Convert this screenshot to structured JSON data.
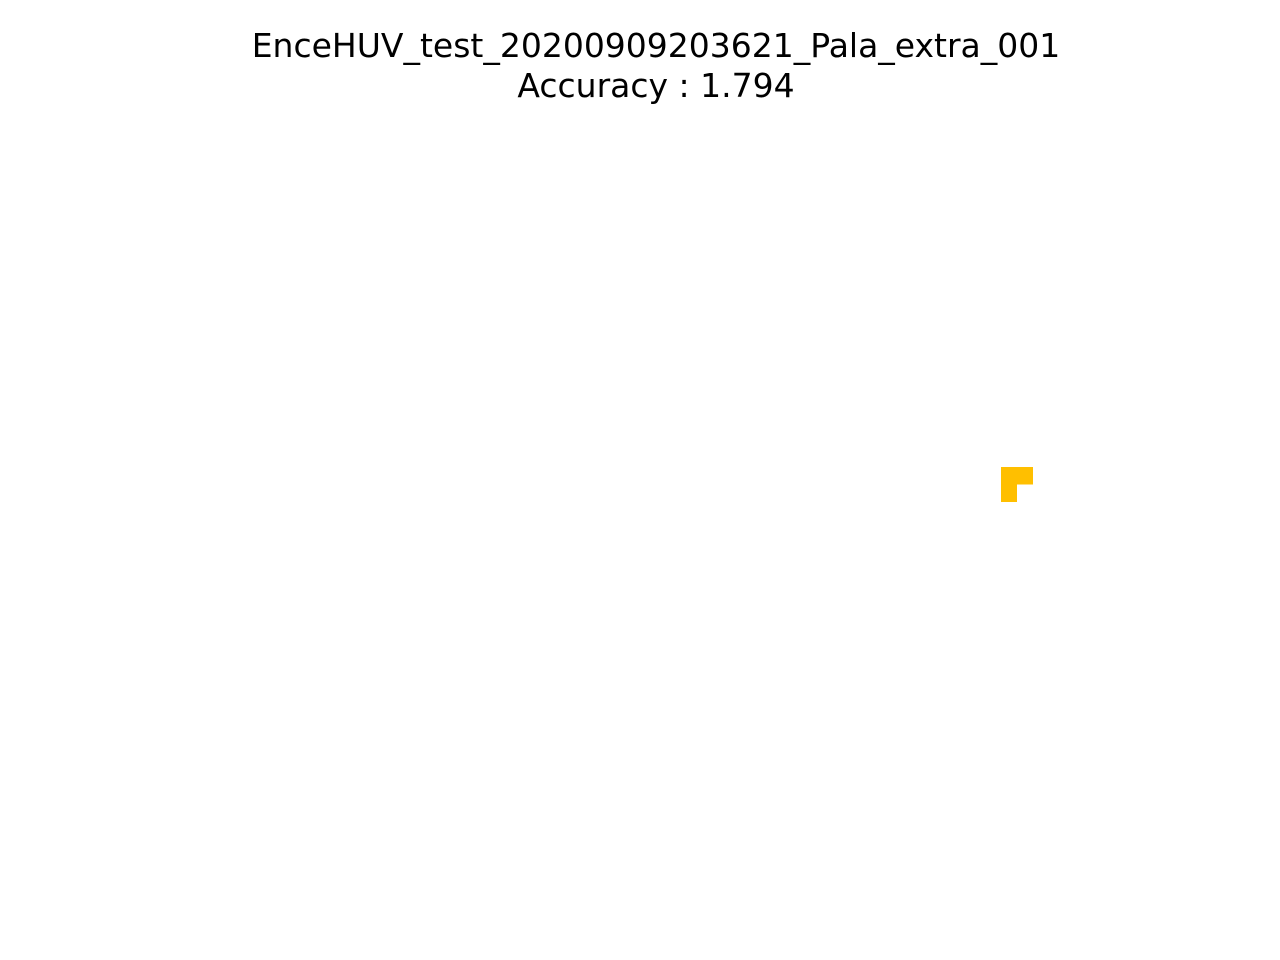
{
  "chart_data": {
    "type": "heatmap",
    "title": "EnceHUV_test_20200909203621_Pala_extra_001",
    "subtitle": "Accuracy : 1.794",
    "axes_visible": false,
    "grid": false,
    "cell_color": "#FFBF00",
    "cells": [
      {
        "row": 0,
        "col": 0,
        "value": 1
      },
      {
        "row": 0,
        "col": 1,
        "value": 1
      },
      {
        "row": 1,
        "col": 0,
        "value": 1
      }
    ]
  }
}
